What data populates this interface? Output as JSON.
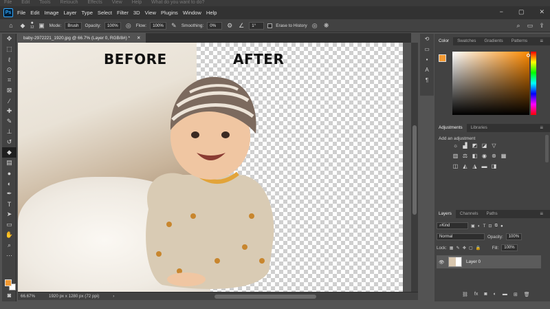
{
  "ghost_bar": {
    "items": [
      "File",
      "Edit",
      "Tools",
      "Retouch",
      "Effects",
      "View",
      "Help",
      "What do you want to do?"
    ]
  },
  "menubar": {
    "logo": "Ps",
    "items": [
      "File",
      "Edit",
      "Image",
      "Layer",
      "Type",
      "Select",
      "Filter",
      "3D",
      "View",
      "Plugins",
      "Window",
      "Help"
    ],
    "window_controls": [
      "−",
      "▢",
      "✕"
    ]
  },
  "options_bar": {
    "brush_size": "12",
    "mode_label": "Mode:",
    "mode_value": "Brush",
    "opacity_label": "Opacity:",
    "opacity_value": "100%",
    "flow_label": "Flow:",
    "flow_value": "100%",
    "smoothing_label": "Smoothing:",
    "smoothing_value": "0%",
    "angle_value": "1°",
    "erase_history_label": "Erase to History"
  },
  "document": {
    "tab_title": "baby-2972221_1920.jpg @ 66.7% (Layer 0, RGB/8#) *",
    "tab_close": "✕",
    "label_before": "BEFORE",
    "label_after": "AFTER"
  },
  "status_bar": {
    "zoom": "66.67%",
    "dimensions": "1920 px x 1280 px (72 ppi)",
    "arrow": "›"
  },
  "color_panel": {
    "tabs": [
      "Color",
      "Swatches",
      "Gradients",
      "Patterns"
    ],
    "foreground": "#f39a32",
    "background": "#ffffff",
    "hue_base": "#ff8a00"
  },
  "adjustments_panel": {
    "tabs": [
      "Adjustments",
      "Libraries"
    ],
    "add_label": "Add an adjustment"
  },
  "layers_panel": {
    "tabs": [
      "Layers",
      "Channels",
      "Paths"
    ],
    "kind_value": "Kind",
    "blend_value": "Normal",
    "opacity_label": "Opacity:",
    "opacity_value": "100%",
    "lock_label": "Lock:",
    "fill_label": "Fill:",
    "fill_value": "100%",
    "layer_name": "Layer 0",
    "footer_fx": "fx"
  }
}
